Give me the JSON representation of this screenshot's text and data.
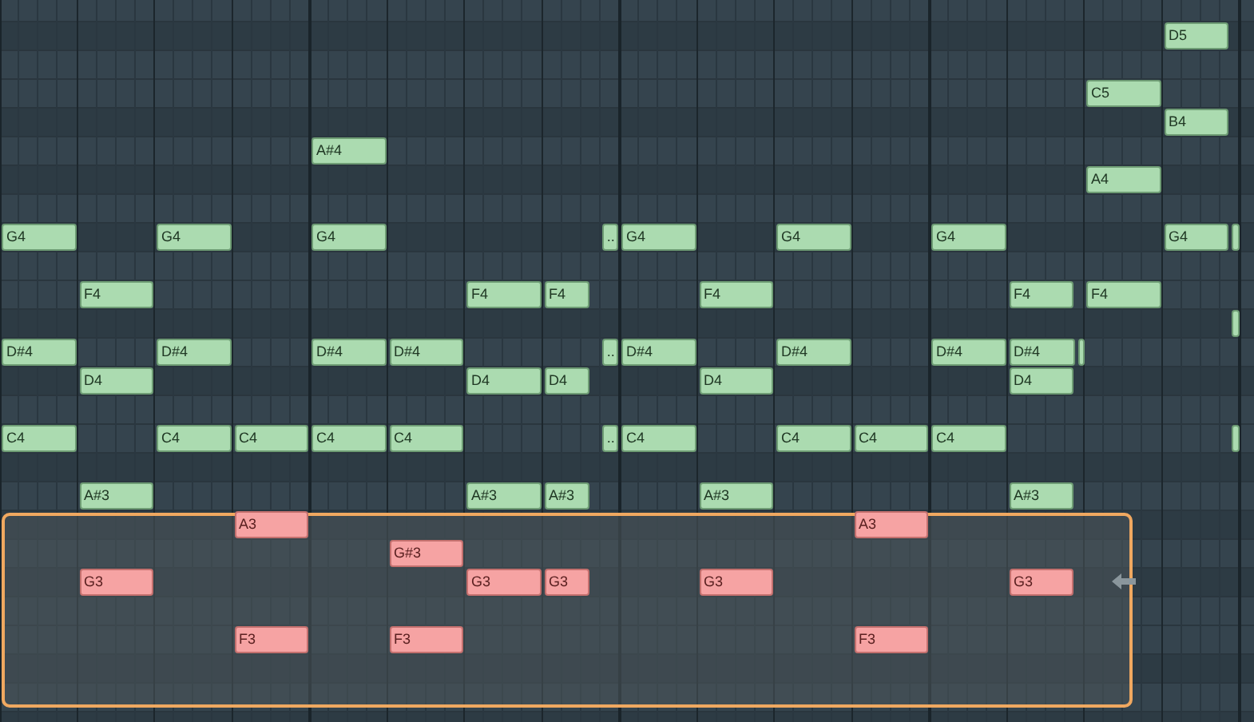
{
  "notes": [
    {
      "label": "D5",
      "selected": false
    },
    {
      "label": "C5",
      "selected": false
    },
    {
      "label": "B4",
      "selected": false
    },
    {
      "label": "A#4",
      "selected": false
    },
    {
      "label": "A4",
      "selected": false
    },
    {
      "label": "G4",
      "selected": false
    },
    {
      "label": "G4",
      "selected": false
    },
    {
      "label": "G4",
      "selected": false
    },
    {
      "label": "..",
      "selected": false
    },
    {
      "label": "G4",
      "selected": false
    },
    {
      "label": "G4",
      "selected": false
    },
    {
      "label": "G4",
      "selected": false
    },
    {
      "label": "G4",
      "selected": false
    },
    {
      "selected": false
    },
    {
      "label": "F4",
      "selected": false
    },
    {
      "label": "F4",
      "selected": false
    },
    {
      "label": "F4",
      "selected": false
    },
    {
      "label": "F4",
      "selected": false
    },
    {
      "label": "F4",
      "selected": false
    },
    {
      "label": "F4",
      "selected": false
    },
    {
      "selected": false
    },
    {
      "label": "D#4",
      "selected": false
    },
    {
      "label": "D#4",
      "selected": false
    },
    {
      "label": "D#4",
      "selected": false
    },
    {
      "label": "D#4",
      "selected": false
    },
    {
      "label": "..",
      "selected": false
    },
    {
      "label": "D#4",
      "selected": false
    },
    {
      "label": "D#4",
      "selected": false
    },
    {
      "label": "D#4",
      "selected": false
    },
    {
      "label": "D#4",
      "selected": false
    },
    {
      "selected": false
    },
    {
      "label": "D4",
      "selected": false
    },
    {
      "label": "D4",
      "selected": false
    },
    {
      "label": "D4",
      "selected": false
    },
    {
      "label": "D4",
      "selected": false
    },
    {
      "label": "D4",
      "selected": false
    },
    {
      "label": "C4",
      "selected": false
    },
    {
      "label": "C4",
      "selected": false
    },
    {
      "label": "C4",
      "selected": false
    },
    {
      "label": "C4",
      "selected": false
    },
    {
      "label": "C4",
      "selected": false
    },
    {
      "label": "..",
      "selected": false
    },
    {
      "label": "C4",
      "selected": false
    },
    {
      "label": "C4",
      "selected": false
    },
    {
      "label": "C4",
      "selected": false
    },
    {
      "label": "C4",
      "selected": false
    },
    {
      "selected": false
    },
    {
      "label": "A#3",
      "selected": false
    },
    {
      "label": "A#3",
      "selected": false
    },
    {
      "label": "A#3",
      "selected": false
    },
    {
      "label": "A#3",
      "selected": false
    },
    {
      "label": "A#3",
      "selected": false
    },
    {
      "label": "A3",
      "selected": true
    },
    {
      "label": "A3",
      "selected": true
    },
    {
      "label": "G#3",
      "selected": true
    },
    {
      "label": "G3",
      "selected": true
    },
    {
      "label": "G3",
      "selected": true
    },
    {
      "label": "G3",
      "selected": true
    },
    {
      "label": "G3",
      "selected": true
    },
    {
      "label": "G3",
      "selected": true
    },
    {
      "label": "F3",
      "selected": true
    },
    {
      "label": "F3",
      "selected": true
    },
    {
      "label": "F3",
      "selected": true
    }
  ]
}
